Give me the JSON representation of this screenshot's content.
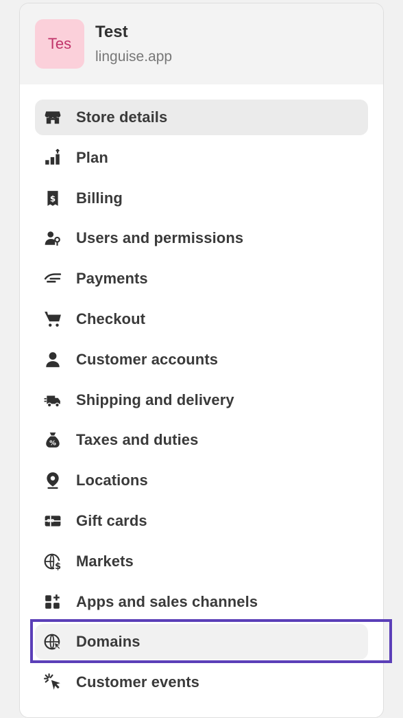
{
  "store": {
    "avatar_text": "Tes",
    "name": "Test",
    "domain": "linguise.app"
  },
  "menu": [
    {
      "label": "Store details",
      "icon": "store-icon",
      "active": true
    },
    {
      "label": "Plan",
      "icon": "plan-icon"
    },
    {
      "label": "Billing",
      "icon": "billing-icon"
    },
    {
      "label": "Users and permissions",
      "icon": "users-icon"
    },
    {
      "label": "Payments",
      "icon": "payments-icon"
    },
    {
      "label": "Checkout",
      "icon": "cart-icon"
    },
    {
      "label": "Customer accounts",
      "icon": "person-icon"
    },
    {
      "label": "Shipping and delivery",
      "icon": "truck-icon"
    },
    {
      "label": "Taxes and duties",
      "icon": "tax-bag-icon"
    },
    {
      "label": "Locations",
      "icon": "location-pin-icon"
    },
    {
      "label": "Gift cards",
      "icon": "gift-card-icon"
    },
    {
      "label": "Markets",
      "icon": "globe-dollar-icon"
    },
    {
      "label": "Apps and sales channels",
      "icon": "apps-icon"
    },
    {
      "label": "Domains",
      "icon": "globe-cursor-icon",
      "highlighted": true
    },
    {
      "label": "Customer events",
      "icon": "cursor-click-icon"
    }
  ],
  "colors": {
    "accent_highlight": "#5b3fb8",
    "avatar_bg": "#fbd0da",
    "avatar_text": "#c0346a"
  }
}
